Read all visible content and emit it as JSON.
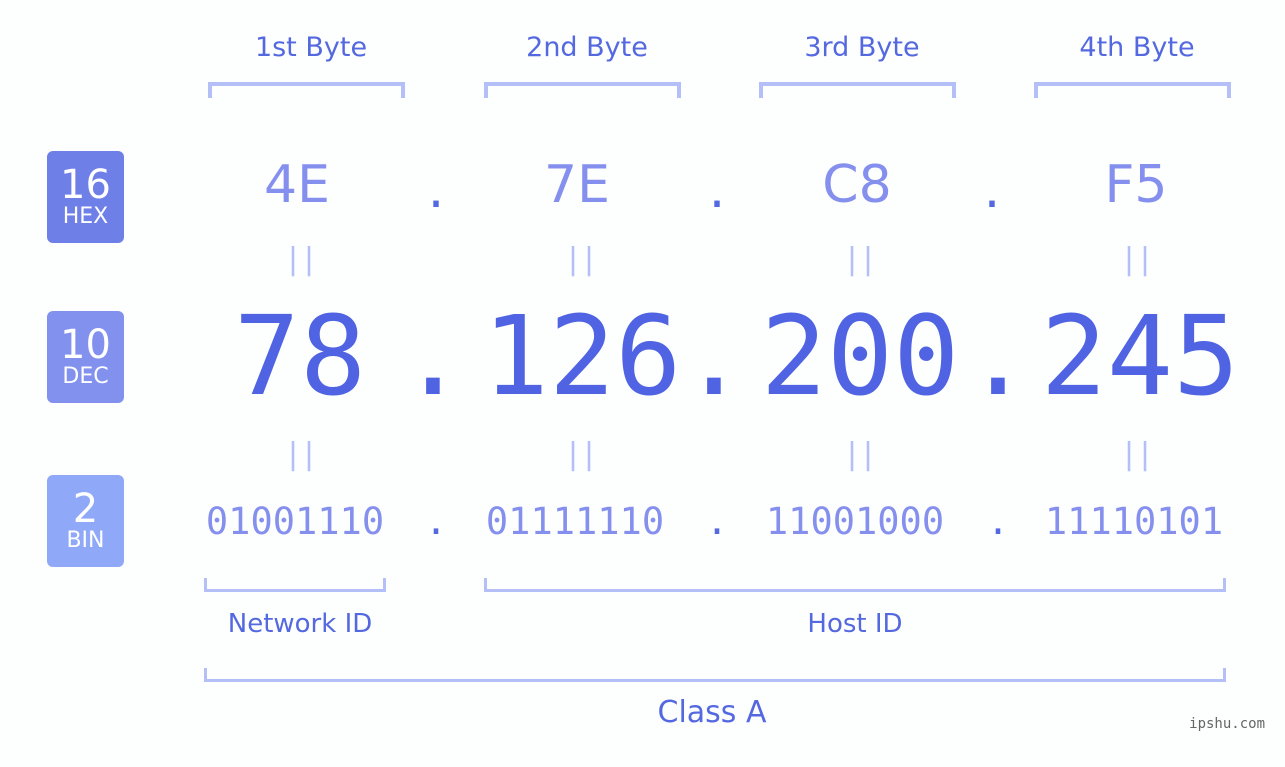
{
  "bytes": {
    "headers": [
      "1st Byte",
      "2nd Byte",
      "3rd Byte",
      "4th Byte"
    ]
  },
  "badges": {
    "hex": {
      "number": "16",
      "label": "HEX",
      "color": "#6f7fe8"
    },
    "dec": {
      "number": "10",
      "label": "DEC",
      "color": "#8291ee"
    },
    "bin": {
      "number": "2",
      "label": "BIN",
      "color": "#8fa8f8"
    }
  },
  "hex": {
    "values": [
      "4E",
      "7E",
      "C8",
      "F5"
    ],
    "separator": "."
  },
  "dec": {
    "values": [
      "78",
      "126",
      "200",
      "245"
    ],
    "separator": "."
  },
  "bin": {
    "values": [
      "01001110",
      "01111110",
      "11001000",
      "11110101"
    ],
    "separator": "."
  },
  "equals_sign": "||",
  "segments": {
    "network": "Network ID",
    "host": "Host ID",
    "class": "Class A"
  },
  "watermark": "ipshu.com",
  "colors": {
    "accent": "#4f63e3",
    "light_accent": "#8590ee",
    "bracket": "#b3bff6"
  }
}
